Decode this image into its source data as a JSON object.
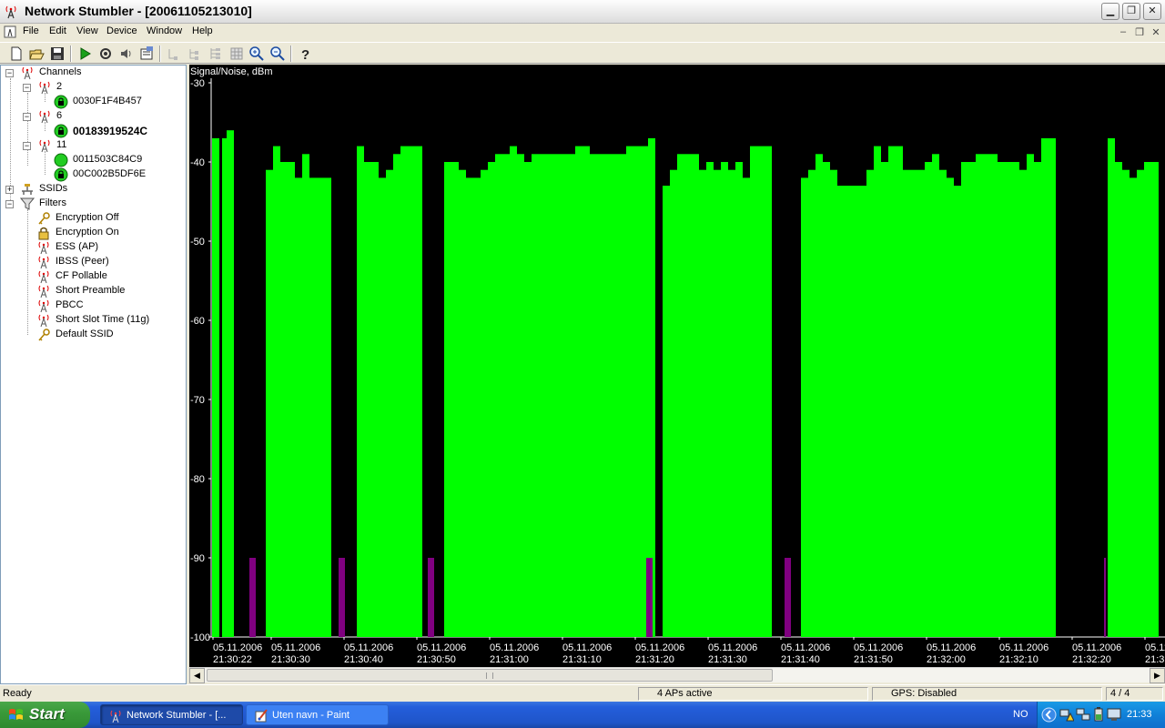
{
  "window": {
    "title": "Network Stumbler - [20061105213010]"
  },
  "menu": [
    "File",
    "Edit",
    "View",
    "Device",
    "Window",
    "Help"
  ],
  "toolbar": {
    "buttons": [
      "new-icon",
      "open-icon",
      "save-icon",
      "play-icon",
      "auto-config-icon",
      "speaker-icon",
      "properties-icon",
      "tree-level1-icon",
      "tree-level2-icon",
      "tree-level3-icon",
      "grid-icon",
      "zoom-in-icon",
      "zoom-out-icon",
      "help-icon"
    ]
  },
  "tree": {
    "channels_label": "Channels",
    "channels": [
      {
        "label": "2",
        "aps": [
          {
            "mac": "0030F1F4B457",
            "state": "locked",
            "bold": false
          }
        ]
      },
      {
        "label": "6",
        "aps": [
          {
            "mac": "00183919524C",
            "state": "locked",
            "bold": true
          }
        ]
      },
      {
        "label": "11",
        "aps": [
          {
            "mac": "0011503C84C9",
            "state": "open",
            "bold": false
          },
          {
            "mac": "00C002B5DF6E",
            "state": "locked",
            "bold": false
          }
        ]
      }
    ],
    "ssids_label": "SSIDs",
    "filters_label": "Filters",
    "filters": [
      "Encryption Off",
      "Encryption On",
      "ESS (AP)",
      "IBSS (Peer)",
      "CF Pollable",
      "Short Preamble",
      "PBCC",
      "Short Slot Time (11g)",
      "Default SSID"
    ]
  },
  "chart_data": {
    "type": "bar",
    "ylabel": "Signal/Noise, dBm",
    "ylim": [
      -100,
      -30
    ],
    "yticks": [
      "-30",
      "-40",
      "-50",
      "-60",
      "-70",
      "-80",
      "-90",
      "-100"
    ],
    "xtick_date": "05.11.2006",
    "xticks": [
      "21:30:22",
      "21:30:30",
      "21:30:40",
      "21:30:50",
      "21:31:00",
      "21:31:10",
      "21:31:20",
      "21:31:30",
      "21:31:40",
      "21:31:50",
      "21:32:00",
      "21:32:10",
      "21:32:20",
      "21:3"
    ],
    "colors": {
      "signal": "#00ff00",
      "noise": "#800080",
      "background": "#000000"
    },
    "signal_runs": [
      [
        [
          -37,
          1
        ],
        [
          -37,
          1
        ],
        [
          -36,
          1
        ]
      ],
      [
        [
          -41,
          1
        ],
        [
          -38,
          1
        ],
        [
          -40,
          2
        ],
        [
          -42,
          1
        ],
        [
          -39,
          1
        ],
        [
          -42,
          3
        ]
      ],
      [
        [
          -38,
          1
        ],
        [
          -40,
          2
        ],
        [
          -42,
          1
        ],
        [
          -41,
          1
        ],
        [
          -39,
          1
        ],
        [
          -38,
          3
        ]
      ],
      [
        [
          -40,
          2
        ],
        [
          -41,
          1
        ],
        [
          -42,
          2
        ],
        [
          -41,
          1
        ],
        [
          -40,
          1
        ],
        [
          -39,
          2
        ],
        [
          -38,
          1
        ],
        [
          -39,
          1
        ],
        [
          -40,
          1
        ],
        [
          -39,
          6
        ],
        [
          -38,
          2
        ],
        [
          -39,
          5
        ],
        [
          -38,
          3
        ],
        [
          -37,
          1
        ]
      ],
      [
        [
          -43,
          1
        ],
        [
          -41,
          1
        ],
        [
          -39,
          3
        ],
        [
          -41,
          1
        ],
        [
          -40,
          1
        ],
        [
          -41,
          1
        ],
        [
          -40,
          1
        ],
        [
          -41,
          1
        ],
        [
          -40,
          1
        ],
        [
          -42,
          1
        ],
        [
          -38,
          3
        ]
      ],
      [
        [
          -42,
          1
        ],
        [
          -41,
          1
        ],
        [
          -39,
          1
        ],
        [
          -40,
          1
        ],
        [
          -41,
          1
        ],
        [
          -43,
          4
        ],
        [
          -41,
          1
        ],
        [
          -38,
          1
        ],
        [
          -40,
          1
        ],
        [
          -38,
          2
        ],
        [
          -41,
          3
        ],
        [
          -40,
          1
        ],
        [
          -39,
          1
        ],
        [
          -41,
          1
        ],
        [
          -42,
          1
        ],
        [
          -43,
          1
        ],
        [
          -40,
          1
        ],
        [
          -40,
          1
        ],
        [
          -39,
          3
        ],
        [
          -40,
          3
        ],
        [
          -41,
          1
        ],
        [
          -39,
          1
        ],
        [
          -40,
          1
        ],
        [
          -37,
          2
        ]
      ],
      [
        [
          -37,
          1
        ],
        [
          -40,
          1
        ],
        [
          -41,
          1
        ],
        [
          -42,
          1
        ],
        [
          -41,
          1
        ],
        [
          -40,
          2
        ]
      ]
    ],
    "noise_value": -90
  },
  "statusbar": {
    "left": "Ready",
    "aps": "4 APs active",
    "gps": "GPS: Disabled",
    "count": "4 / 4"
  },
  "taskbar": {
    "start": "Start",
    "tasks": [
      {
        "label": "Network Stumbler - [...",
        "active": true
      },
      {
        "label": "Uten navn - Paint",
        "active": false
      }
    ],
    "lang": "NO",
    "clock": "21:33"
  }
}
